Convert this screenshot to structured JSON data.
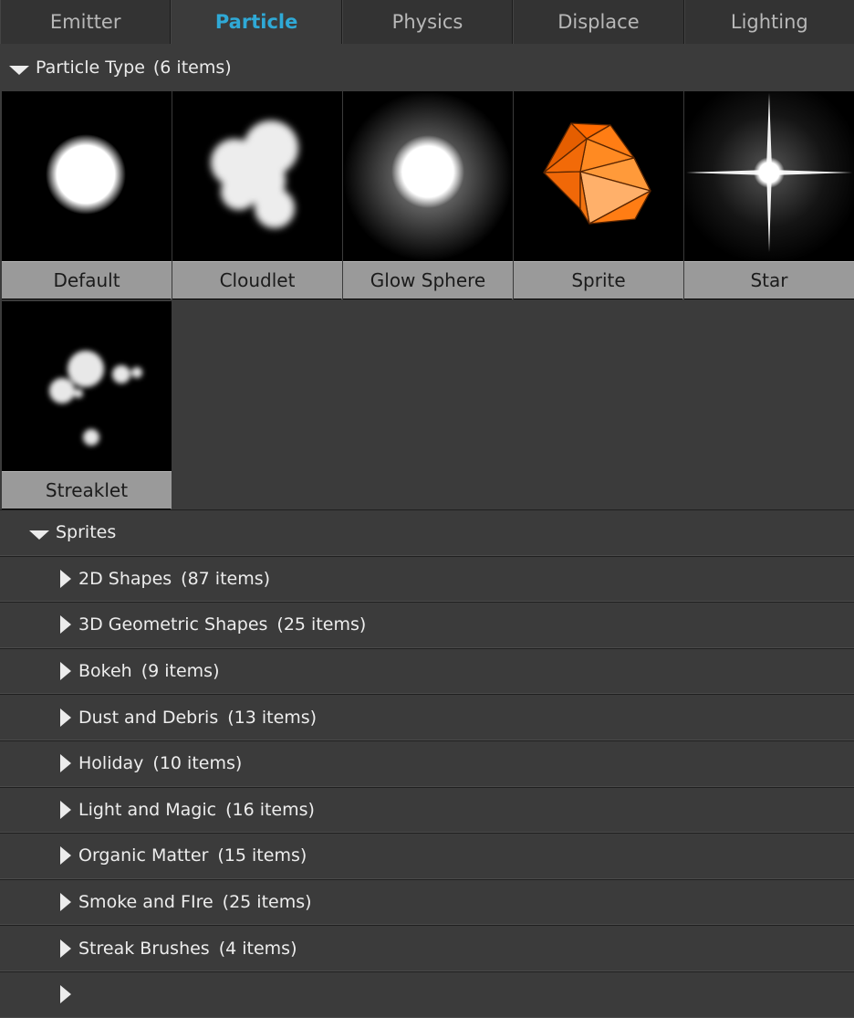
{
  "tabs": [
    {
      "label": "Emitter",
      "active": false
    },
    {
      "label": "Particle",
      "active": true
    },
    {
      "label": "Physics",
      "active": false
    },
    {
      "label": "Displace",
      "active": false
    },
    {
      "label": "Lighting",
      "active": false
    }
  ],
  "section": {
    "title": "Particle Type",
    "count": "(6 items)",
    "items": [
      {
        "label": "Default",
        "icon": "default-particle-icon"
      },
      {
        "label": "Cloudlet",
        "icon": "cloudlet-particle-icon"
      },
      {
        "label": "Glow Sphere",
        "icon": "glow-sphere-particle-icon"
      },
      {
        "label": "Sprite",
        "icon": "sprite-icosahedron-icon"
      },
      {
        "label": "Star",
        "icon": "star-particle-icon"
      },
      {
        "label": "Streaklet",
        "icon": "streaklet-particle-icon"
      }
    ]
  },
  "sprites": {
    "title": "Sprites",
    "folders": [
      {
        "name": "2D Shapes",
        "count": "(87 items)"
      },
      {
        "name": "3D Geometric Shapes",
        "count": "(25 items)"
      },
      {
        "name": "Bokeh",
        "count": "(9 items)"
      },
      {
        "name": "Dust and Debris",
        "count": "(13 items)"
      },
      {
        "name": "Holiday",
        "count": "(10 items)"
      },
      {
        "name": "Light and Magic",
        "count": "(16 items)"
      },
      {
        "name": "Organic Matter",
        "count": "(15 items)"
      },
      {
        "name": "Smoke and FIre",
        "count": "(25 items)"
      },
      {
        "name": "Streak Brushes",
        "count": "(4 items)"
      },
      {
        "name": "",
        "count": ""
      }
    ]
  },
  "colors": {
    "active_tab": "#2fa9d6",
    "panel_bg": "#3b3b3b",
    "label_bg": "#9a9a9a",
    "sprite_orange": "#ff7a10"
  }
}
